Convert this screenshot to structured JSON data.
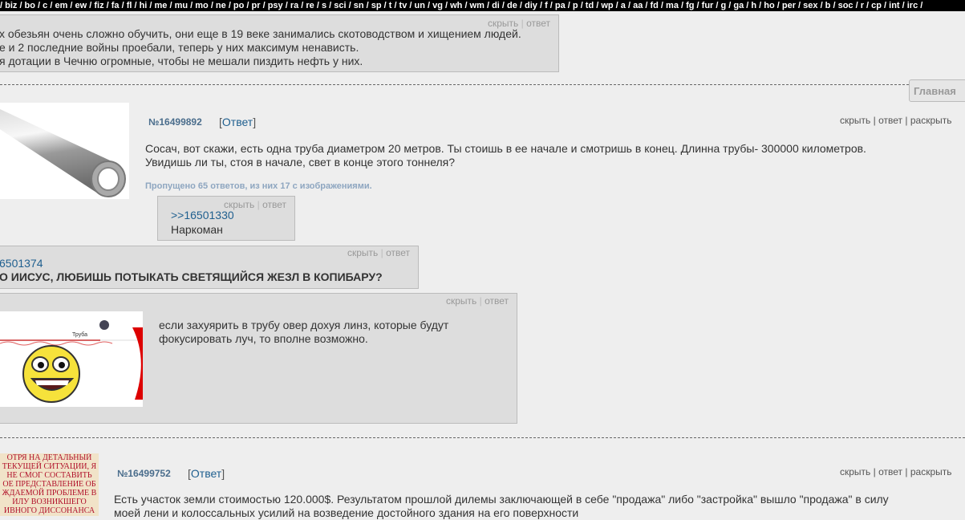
{
  "boards_nav": "/ biz / bo / c / em / ew / fiz / fa / fl / hi / me / mu / mo / ne / po / pr / psy / ra / re / s / sci / sn / sp / t / tv / un / vg / wh / wm / di / de / diy / f / pa / p / td / wp / a / aa / fd / ma / fg / fur / g / ga / h / ho / per / sex / b / soc / r / cp / int / irc /",
  "actions": {
    "hide": "скрыть",
    "reply": "ответ",
    "expand": "раскрыть",
    "sep": "|"
  },
  "home_button": "Главная",
  "top_reply": {
    "lines": [
      "х обезьян очень сложно обучить, они еще в 19 веке занимались скотоводством и хищением людей.",
      "е и 2 последние войны проебали, теперь у них максимум ненависть.",
      "я дотации в Чечню огромные, чтобы не мешали пиздить нефть у них."
    ]
  },
  "thread1": {
    "number": "№16499892",
    "reply_label": "Ответ",
    "lines": [
      "Сосач, вот скажи, есть одна труба диаметром 20 метров. Ты стоишь в ее начале и смотришь в конец. Длинна трубы- 300000 километров.",
      "Увидишь ли ты, стоя в начале, свет в конце этого тоннеля?"
    ],
    "omitted": "Пропущено 65 ответов, из них 17 с изображениями.",
    "replies": [
      {
        "quote": ">>16501330",
        "text": "Наркоман"
      },
      {
        "quote": "6501374",
        "text": "О ИИСУС, ЛЮБИШЬ ПОТЫКАТЬ СВЕТЯЩИЙСЯ ЖЕЗЛ В КОПИБАРУ?"
      },
      {
        "lines": [
          "если захуярить в трубу овер дохуя линз, которые будут",
          "фокусировать луч, то вполне возможно."
        ],
        "image_label": "Труба"
      }
    ]
  },
  "thread2": {
    "number": "№16499752",
    "reply_label": "Ответ",
    "lines": [
      "Есть участок земли стоимостью 120.000$. Результатом прошлой дилемы заключающей в себе \"продажа\" либо \"застройка\" вышло \"продажа\" в силу",
      "моей лени и колоссальных усилий на возведение достойного здания на его поверхности"
    ],
    "image_text": [
      "ОТРЯ НА ДЕТАЛЬНЫЙ",
      "ТЕКУЩЕЙ СИТУАЦИИ, Я",
      "НЕ СМОГ СОСТАВИТЬ",
      "ОЕ ПРЕДСТАВЛЕНИЕ ОБ",
      "ЖДАЕМОЙ ПРОБЛЕМЕ В",
      "ИЛУ ВОЗНИКШЕГО",
      "ИВНОГО ДИССОНАНСА"
    ]
  }
}
